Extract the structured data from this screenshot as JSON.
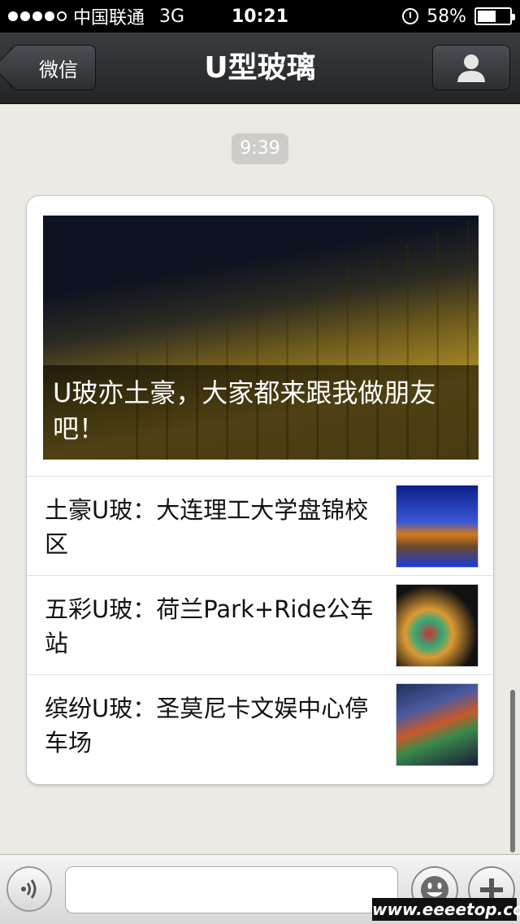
{
  "status_bar": {
    "carrier": "中国联通",
    "network": "3G",
    "time": "10:21",
    "battery": "58%",
    "battery_level": 0.58
  },
  "nav": {
    "back_label": "微信",
    "title": "U型玻璃"
  },
  "chat": {
    "timestamp": "9:39",
    "cover_caption": "U玻亦土豪，大家都来跟我做朋友吧！",
    "articles": [
      {
        "title": "土豪U玻：大连理工大学盘锦校区",
        "thumb": "building-photo"
      },
      {
        "title": "五彩U玻：荷兰Park+Ride公车站",
        "thumb": "bus-station-photo"
      },
      {
        "title": "缤纷U玻：圣莫尼卡文娱中心停车场",
        "thumb": "parking-photo"
      }
    ]
  },
  "input_bar": {
    "placeholder": ""
  },
  "watermark": "www.eeeetop.com",
  "colors": {
    "nav_bg": "#2a2c2f",
    "chat_bg": "#eceae5",
    "card_bg": "#ffffff"
  }
}
